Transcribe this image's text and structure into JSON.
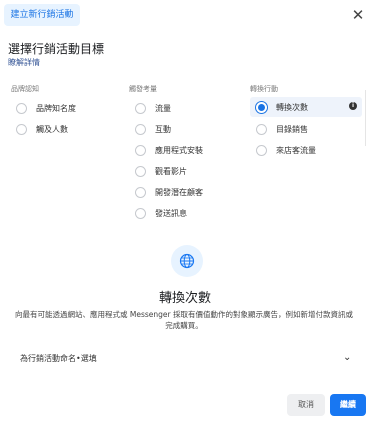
{
  "header": {
    "title": "建立新行銷活動",
    "close_icon": "close-icon"
  },
  "objective_section": {
    "heading": "選擇行銷活動目標",
    "learn_more": "瞭解詳情"
  },
  "columns": [
    {
      "heading": "品牌認知",
      "options": [
        "品牌知名度",
        "觸及人數"
      ]
    },
    {
      "heading": "觸發考量",
      "options": [
        "流量",
        "互動",
        "應用程式安裝",
        "觀看影片",
        "開發潛在顧客",
        "發送訊息"
      ]
    },
    {
      "heading": "轉換行動",
      "options": [
        "轉換次數",
        "目錄銷售",
        "來店客流量"
      ],
      "selected": "轉換次數"
    }
  ],
  "selected_objective": {
    "icon": "globe-icon",
    "title": "轉換次數",
    "description": "向最有可能透過網站、應用程式或 Messenger 採取有價值動作的對象顯示廣告，例如新增付款資訊或完成購買。"
  },
  "naming": {
    "label": "為行銷活動命名•選填"
  },
  "footer": {
    "cancel_label": "取消",
    "continue_label": "繼續"
  },
  "colors": {
    "accent": "#1877f2",
    "pill_bg": "#e7f3ff",
    "selected_row_bg": "#eef3fb"
  }
}
